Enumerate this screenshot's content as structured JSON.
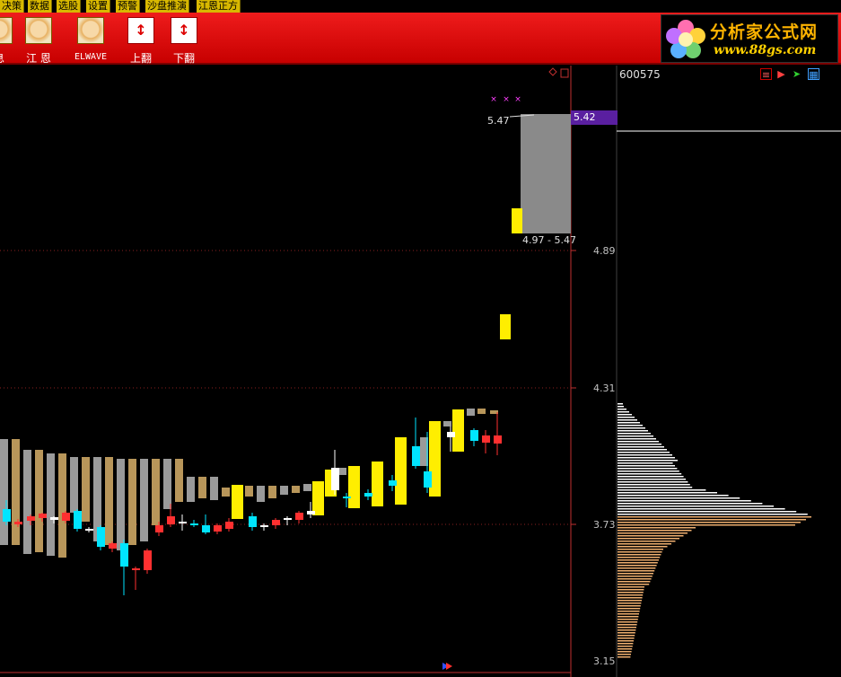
{
  "menu": {
    "items": [
      "决策",
      "数据",
      "选股",
      "设置",
      "预警",
      "沙盘推演",
      "江恩正方"
    ]
  },
  "toolbar": {
    "buttons": [
      {
        "label": "息"
      },
      {
        "label": "江 恩"
      },
      {
        "label": "ELWAVE"
      },
      {
        "label": "上翻"
      },
      {
        "label": "下翻"
      }
    ]
  },
  "logo": {
    "title": "分析家公式网",
    "url": "www.88gs.com"
  },
  "chart": {
    "stock_code": "600575",
    "price_tag": "5.42",
    "peak_label": "5.47",
    "range_label": "4.97 - 5.47",
    "y_axis_labels": [
      "4.89",
      "4.31",
      "3.73",
      "3.15"
    ],
    "colors": {
      "up": "#ff3030",
      "down": "#00e5ff",
      "yellow_block": "#ffee00",
      "gray_bar": "#9a9a9a",
      "tan_bar": "#b8965a",
      "profile_white": "#ffffff",
      "profile_tan": "#f0b070",
      "price_tag_bg": "#5a1fa0"
    }
  },
  "chart_data": {
    "type": "table",
    "y_axis_ticks": [
      3.15,
      3.73,
      4.31,
      4.89
    ],
    "highlight_range": [
      4.97,
      5.47
    ],
    "current_price": 5.42,
    "peak": 5.47
  }
}
